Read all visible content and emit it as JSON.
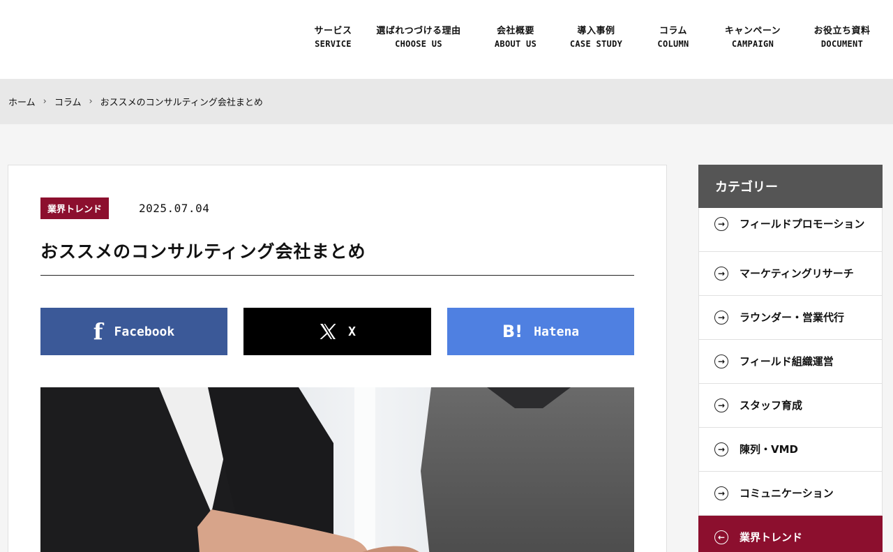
{
  "nav": [
    {
      "jp": "サービス",
      "en": "SERVICE"
    },
    {
      "jp": "選ばれつづける理由",
      "en": "CHOOSE US"
    },
    {
      "jp": "会社概要",
      "en": "ABOUT US"
    },
    {
      "jp": "導入事例",
      "en": "CASE STUDY"
    },
    {
      "jp": "コラム",
      "en": "COLUMN"
    },
    {
      "jp": "キャンペーン",
      "en": "CAMPAIGN"
    },
    {
      "jp": "お役立ち資料",
      "en": "DOCUMENT"
    }
  ],
  "breadcrumb": {
    "home": "ホーム",
    "column": "コラム",
    "current": "おススメのコンサルティング会社まとめ"
  },
  "article": {
    "tag": "業界トレンド",
    "date": "2025.07.04",
    "title": "おススメのコンサルティング会社まとめ"
  },
  "share": {
    "facebook": "Facebook",
    "x": "X",
    "hatena": "Hatena"
  },
  "sidebar": {
    "heading": "カテゴリー",
    "items": [
      {
        "label": "フィールドプロモーション"
      },
      {
        "label": "マーケティングリサーチ"
      },
      {
        "label": "ラウンダー・営業代行"
      },
      {
        "label": "フィールド組織運営"
      },
      {
        "label": "スタッフ育成"
      },
      {
        "label": "陳列・VMD"
      },
      {
        "label": "コミュニケーション"
      },
      {
        "label": "業界トレンド"
      }
    ]
  },
  "colors": {
    "accent": "#8c0f2e",
    "facebook": "#3b5998",
    "x": "#000000",
    "hatena": "#4f80e1",
    "sidebar_head": "#555555"
  }
}
